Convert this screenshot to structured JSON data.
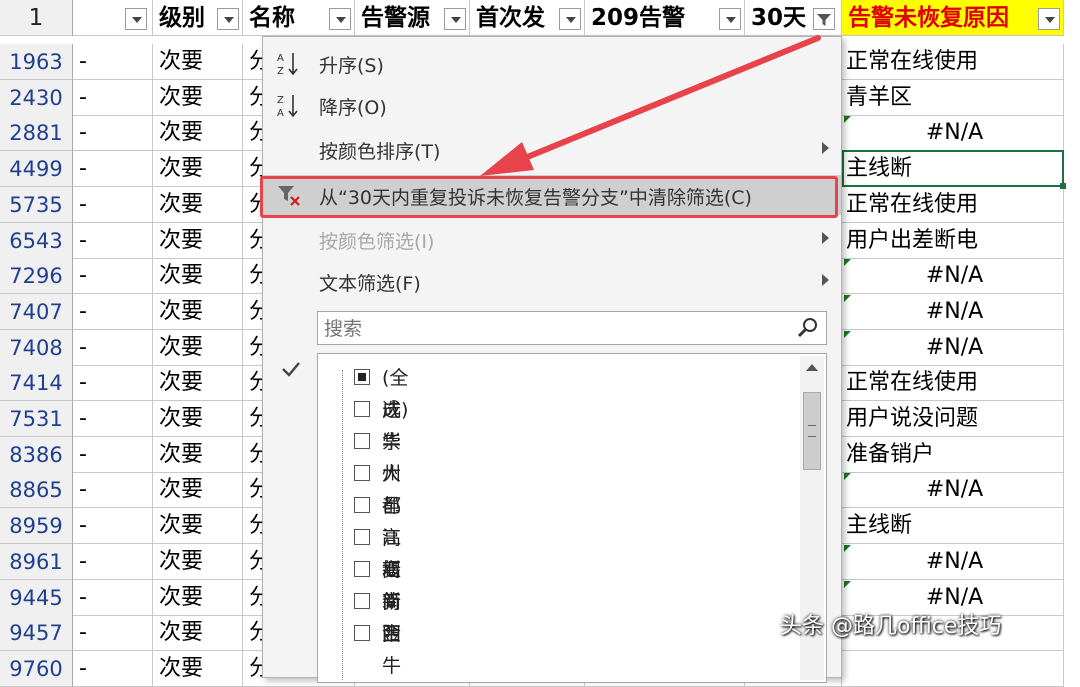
{
  "header": {
    "row_label": "1",
    "columns": [
      "",
      "级别",
      "名称",
      "告警源",
      "首次发",
      "209告警",
      "30天",
      "告警未恢复原因"
    ]
  },
  "rows": [
    {
      "num": "1963",
      "a": "-",
      "level": "次要",
      "name": "分",
      "reason": "正常在线使用",
      "na": false
    },
    {
      "num": "2430",
      "a": "-",
      "level": "次要",
      "name": "分",
      "reason": "青羊区",
      "na": false
    },
    {
      "num": "2881",
      "a": "-",
      "level": "次要",
      "name": "分",
      "reason": "#N/A",
      "na": true
    },
    {
      "num": "4499",
      "a": "-",
      "level": "次要",
      "name": "分",
      "reason": "主线断",
      "na": false
    },
    {
      "num": "5735",
      "a": "-",
      "level": "次要",
      "name": "分",
      "reason": "正常在线使用",
      "na": false
    },
    {
      "num": "6543",
      "a": "-",
      "level": "次要",
      "name": "分",
      "reason": "用户出差断电",
      "na": false
    },
    {
      "num": "7296",
      "a": "-",
      "level": "次要",
      "name": "分",
      "reason": "#N/A",
      "na": true
    },
    {
      "num": "7407",
      "a": "-",
      "level": "次要",
      "name": "分",
      "reason": "#N/A",
      "na": true
    },
    {
      "num": "7408",
      "a": "-",
      "level": "次要",
      "name": "分",
      "reason": "#N/A",
      "na": true
    },
    {
      "num": "7414",
      "a": "-",
      "level": "次要",
      "name": "分",
      "reason": "正常在线使用",
      "na": false
    },
    {
      "num": "7531",
      "a": "-",
      "level": "次要",
      "name": "分",
      "reason": "用户说没问题",
      "na": false
    },
    {
      "num": "8386",
      "a": "-",
      "level": "次要",
      "name": "分",
      "reason": "准备销户",
      "na": false
    },
    {
      "num": "8865",
      "a": "-",
      "level": "次要",
      "name": "分",
      "reason": "#N/A",
      "na": true
    },
    {
      "num": "8959",
      "a": "-",
      "level": "次要",
      "name": "分",
      "reason": "主线断",
      "na": false
    },
    {
      "num": "8961",
      "a": "-",
      "level": "次要",
      "name": "分",
      "reason": "#N/A",
      "na": true
    },
    {
      "num": "9445",
      "a": "-",
      "level": "次要",
      "name": "分",
      "reason": "#N/A",
      "na": true
    },
    {
      "num": "9457",
      "a": "-",
      "level": "次要",
      "name": "分",
      "reason": "",
      "na": false
    },
    {
      "num": "9760",
      "a": "-",
      "level": "次要",
      "name": "分",
      "reason": "",
      "na": false
    }
  ],
  "menu": {
    "sort_asc": "升序(S)",
    "sort_desc": "降序(O)",
    "sort_color": "按颜色排序(T)",
    "clear_filter": "从“30天内重复投诉未恢复告警分支”中清除筛选(C)",
    "filter_color": "按颜色筛选(I)",
    "text_filter": "文本筛选(F)",
    "search_placeholder": "搜索",
    "items": [
      {
        "label": "(全选)",
        "checked": true
      },
      {
        "label": "成华",
        "checked": false
      },
      {
        "label": "崇州",
        "checked": false
      },
      {
        "label": "大邑",
        "checked": false
      },
      {
        "label": "都江堰",
        "checked": false
      },
      {
        "label": "高新南",
        "checked": false
      },
      {
        "label": "高新西",
        "checked": false
      },
      {
        "label": "简阳",
        "checked": false
      },
      {
        "label": "金牛",
        "checked": false
      }
    ]
  },
  "watermark": "头条 @路几office技巧",
  "colors": {
    "header_yellow": "#ffff00",
    "header_red_text": "#e00000",
    "highlight_red": "#e8424a"
  }
}
